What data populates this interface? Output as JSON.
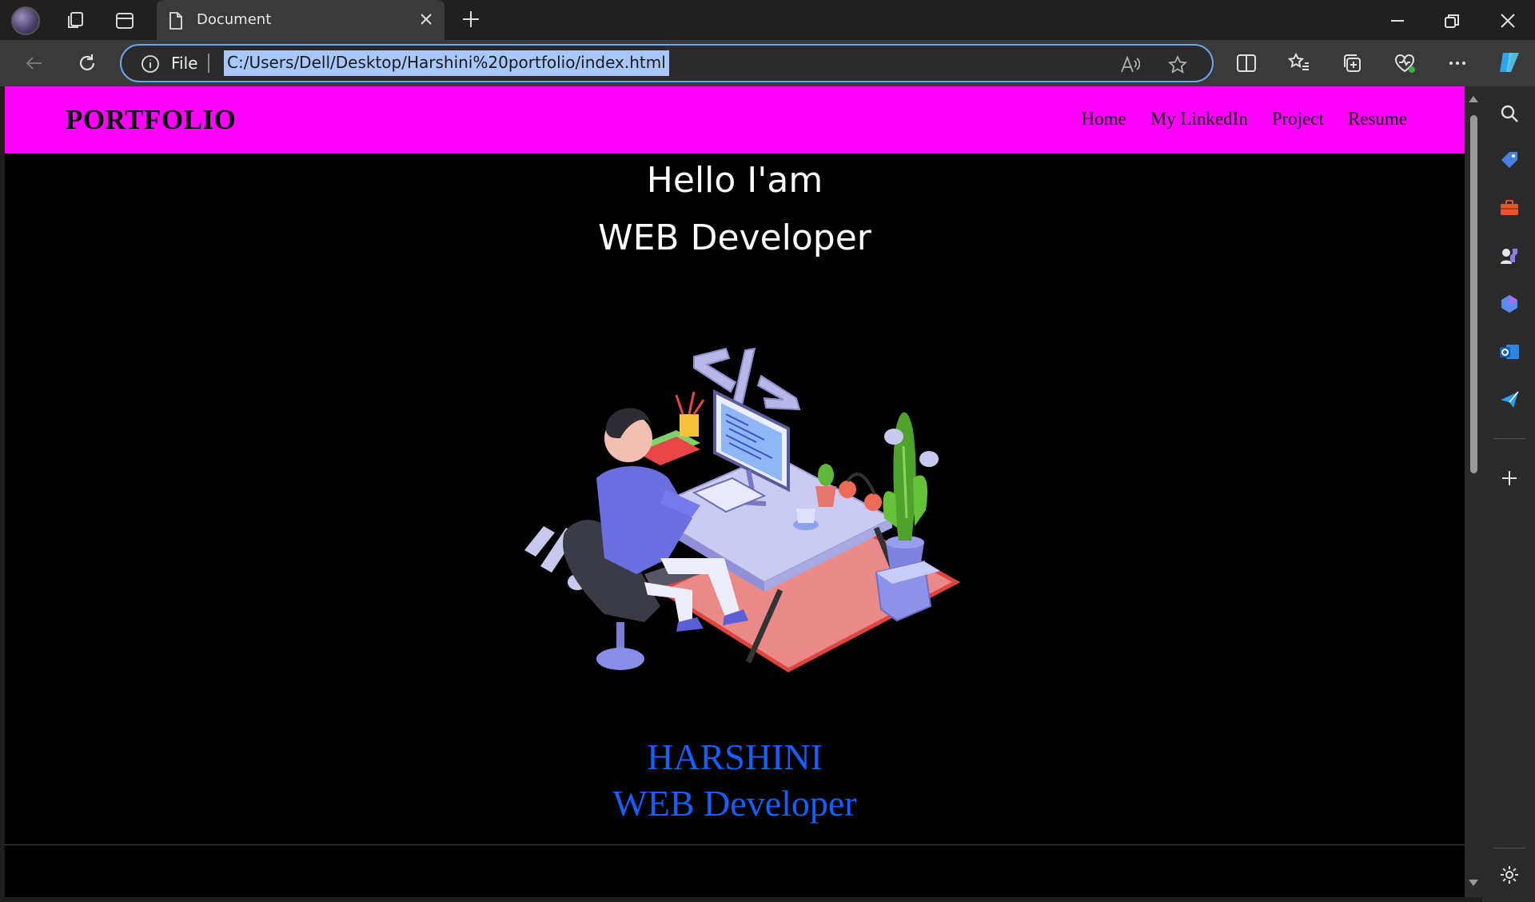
{
  "browser": {
    "tab_title": "Document",
    "address_scheme": "File",
    "url": "C:/Users/Dell/Desktop/Harshini%20portfolio/index.html"
  },
  "page": {
    "logo": "PORTFOLIO",
    "nav": [
      {
        "label": "Home"
      },
      {
        "label": "My LinkedIn"
      },
      {
        "label": "Project"
      },
      {
        "label": "Resume"
      }
    ],
    "hero_line1": "Hello I'am",
    "hero_line2": "WEB Developer",
    "name": "HARSHINI",
    "role": "WEB Developer"
  },
  "colors": {
    "navbar": "#ff00ff",
    "page_bg": "#000000",
    "name_text": "#1560ff",
    "hero_text": "#ffffff"
  },
  "icons": {
    "illustration": "web-developer-at-desk-illustration"
  }
}
